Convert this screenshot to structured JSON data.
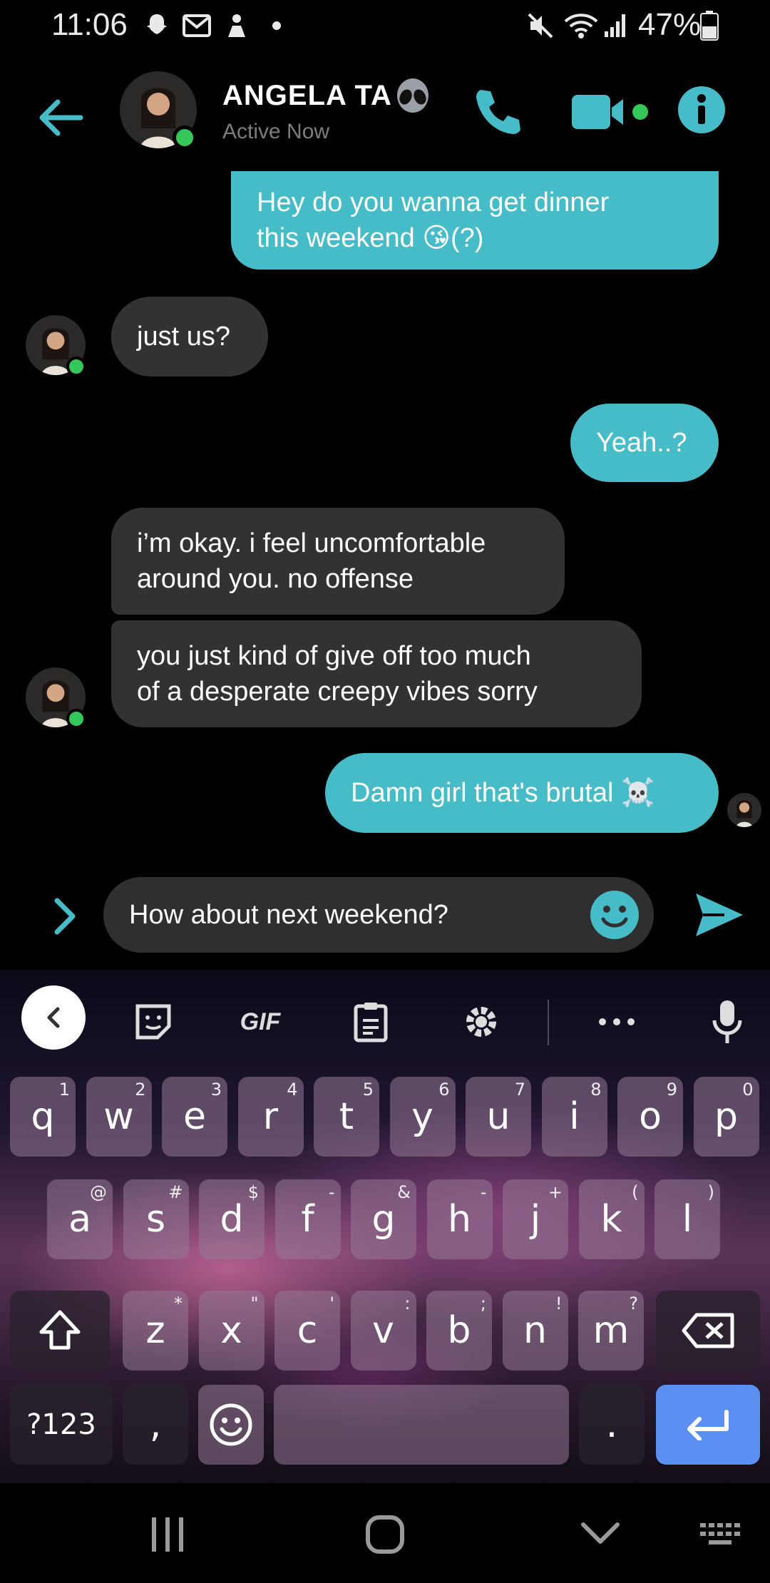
{
  "status_bar": {
    "time": "11:06",
    "battery": "47%"
  },
  "header": {
    "name": "ANGELA TA",
    "status": "Active Now"
  },
  "messages": [
    {
      "dir": "out",
      "text": "Hey do you wanna get dinner\nthis weekend 😘(?)"
    },
    {
      "dir": "in",
      "text": "just us?"
    },
    {
      "dir": "out",
      "text": "Yeah..?"
    },
    {
      "dir": "in",
      "text": "i’m okay. i feel uncomfortable\naround you. no offense"
    },
    {
      "dir": "in",
      "text": "you just kind of give off too much\nof a desperate creepy vibes sorry"
    },
    {
      "dir": "out",
      "text": "Damn girl that's brutal ☠️"
    }
  ],
  "composer": {
    "value": "How about next weekend?"
  },
  "keyboard": {
    "toolbar_gif": "GIF",
    "row1": [
      {
        "k": "q",
        "h": "1"
      },
      {
        "k": "w",
        "h": "2"
      },
      {
        "k": "e",
        "h": "3"
      },
      {
        "k": "r",
        "h": "4"
      },
      {
        "k": "t",
        "h": "5"
      },
      {
        "k": "y",
        "h": "6"
      },
      {
        "k": "u",
        "h": "7"
      },
      {
        "k": "i",
        "h": "8"
      },
      {
        "k": "o",
        "h": "9"
      },
      {
        "k": "p",
        "h": "0"
      }
    ],
    "row2": [
      {
        "k": "a",
        "h": "@"
      },
      {
        "k": "s",
        "h": "#"
      },
      {
        "k": "d",
        "h": "$"
      },
      {
        "k": "f",
        "h": "-"
      },
      {
        "k": "g",
        "h": "&"
      },
      {
        "k": "h",
        "h": "-"
      },
      {
        "k": "j",
        "h": "+"
      },
      {
        "k": "k",
        "h": "("
      },
      {
        "k": "l",
        "h": ")"
      }
    ],
    "row3": [
      {
        "k": "z",
        "h": "*"
      },
      {
        "k": "x",
        "h": "\""
      },
      {
        "k": "c",
        "h": "'"
      },
      {
        "k": "v",
        "h": ":"
      },
      {
        "k": "b",
        "h": ";"
      },
      {
        "k": "n",
        "h": "!"
      },
      {
        "k": "m",
        "h": "?"
      }
    ],
    "symbols_label": "?123",
    "comma": ",",
    "period": "."
  },
  "colors": {
    "accent": "#45bcc7",
    "incoming": "#323232",
    "online": "#34c759",
    "enter": "#5b8ff2"
  }
}
